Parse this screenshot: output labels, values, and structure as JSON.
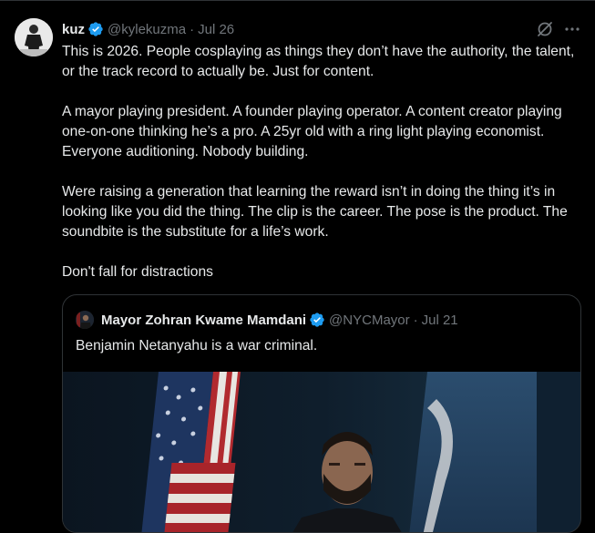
{
  "tweet": {
    "author_name": "kuz",
    "handle": "@kylekuzma",
    "separator": "·",
    "time": "Jul 26",
    "paragraphs": [
      "This is 2026. People cosplaying as things they don’t have the authority, the talent, or the track record to actually be. Just for content.",
      "A mayor playing president. A founder playing operator. A content creator playing one-on-one thinking he’s a pro. A 25yr old with a ring light playing economist. Everyone auditioning. Nobody building.",
      "Were raising a generation that learning the reward isn’t in doing the thing it’s in looking like you did the thing. The clip is the career. The pose is the product. The soundbite is the substitute for a life’s work.",
      "Don't fall for distractions"
    ],
    "icons": {
      "verified": "verified-badge-icon",
      "grok": "grok-icon",
      "more": "more-icon"
    }
  },
  "quote": {
    "author_name": "Mayor Zohran Kwame Mamdani",
    "handle": "@NYCMayor",
    "separator": "·",
    "time": "Jul 21",
    "text": "Benjamin Netanyahu is a war criminal."
  },
  "colors": {
    "background": "#000000",
    "text": "#e7e9ea",
    "secondary": "#71767b",
    "verified": "#1d9bf0",
    "border": "#2f3336"
  }
}
